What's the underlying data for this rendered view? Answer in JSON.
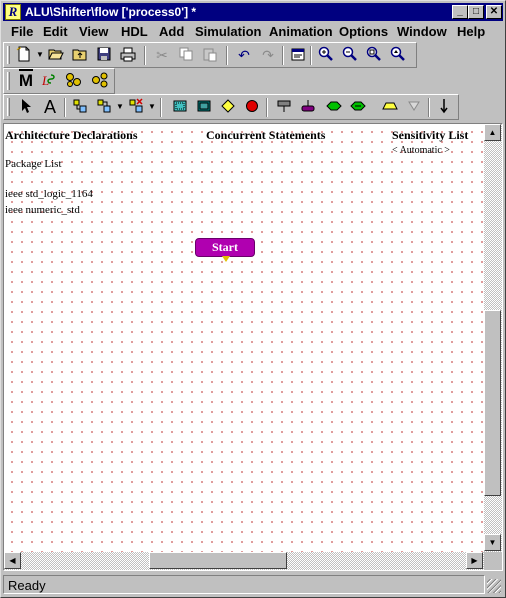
{
  "window": {
    "title": "ALU\\Shifter\\flow ['process0'] *",
    "app_icon_glyph": "R"
  },
  "title_buttons": {
    "minimize": "_",
    "maximize": "□",
    "close": "✕"
  },
  "menu": [
    "File",
    "Edit",
    "View",
    "HDL",
    "Add",
    "Simulation",
    "Animation",
    "Options",
    "Window",
    "Help"
  ],
  "headers": {
    "arch": "Architecture Declarations",
    "concurrent": "Concurrent Statements",
    "sensitivity": "Sensitivity List"
  },
  "sensitivity_value": "< Automatic >",
  "package_list_label": "Package List",
  "packages": [
    "ieee std_logic_1164",
    "ieee numeric_std"
  ],
  "start_label": "Start",
  "status": "Ready",
  "colors": {
    "title_bar": "#000080",
    "start_node": "#b000b0",
    "grid_dot": "#d77f7f"
  }
}
